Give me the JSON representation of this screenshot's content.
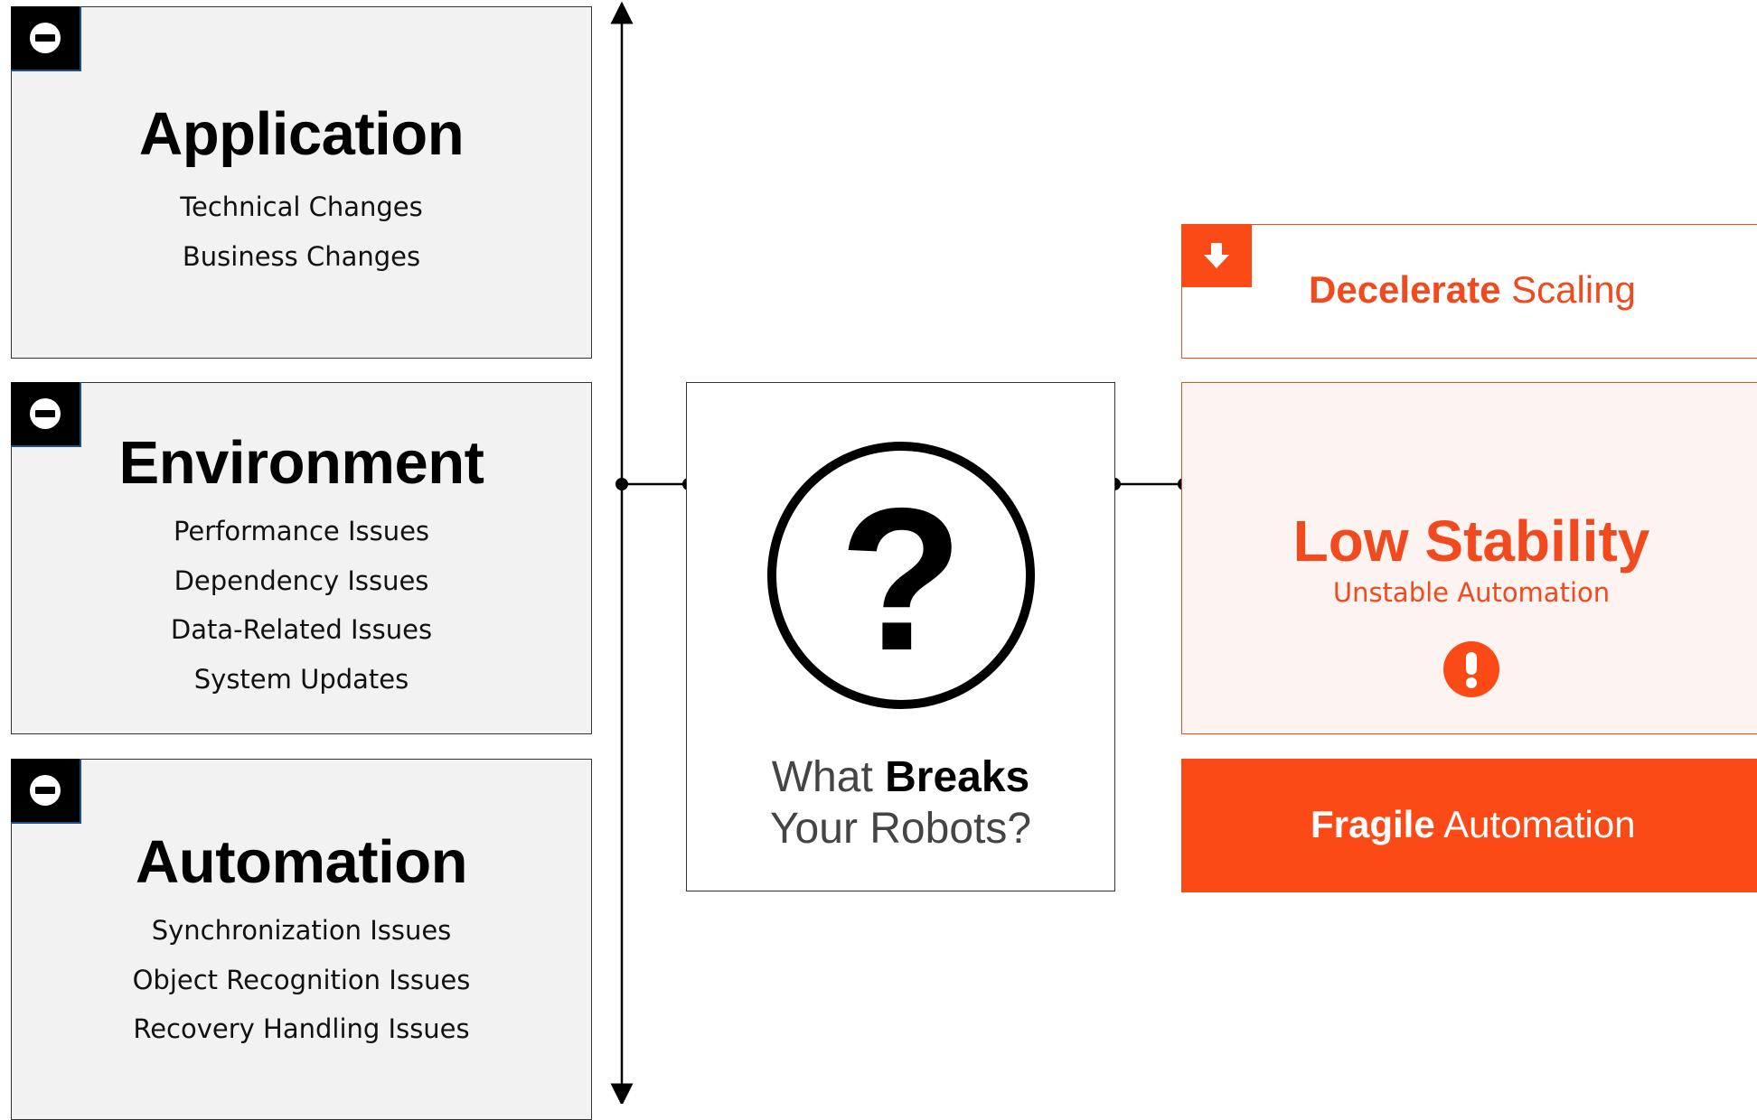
{
  "categories": [
    {
      "title": "Application",
      "icon": "minus-circle-icon",
      "items": [
        "Technical Changes",
        "Business Changes"
      ]
    },
    {
      "title": "Environment",
      "icon": "minus-circle-icon",
      "items": [
        "Performance Issues",
        "Dependency  Issues",
        "Data-Related Issues",
        "System Updates"
      ]
    },
    {
      "title": "Automation",
      "icon": "minus-circle-icon",
      "items": [
        "Synchronization Issues",
        "Object Recognition Issues",
        "Recovery Handling Issues"
      ]
    }
  ],
  "center": {
    "icon": "question-circle-icon",
    "line1_light": "What",
    "line1_bold": "Breaks",
    "line2": "Your Robots?"
  },
  "outcomes": {
    "decelerate": {
      "icon": "arrow-down-icon",
      "bold": "Decelerate",
      "rest": " Scaling"
    },
    "stability": {
      "title": "Low Stability",
      "subtitle": "Unstable Automation",
      "icon": "exclamation-circle-icon"
    },
    "fragile": {
      "bold": "Fragile",
      "rest": " Automation"
    }
  },
  "colors": {
    "accent": "#fc4a17",
    "accent_text": "#f04a1e",
    "card_bg": "#f2f2f2",
    "stability_bg": "#fdf3f1"
  }
}
